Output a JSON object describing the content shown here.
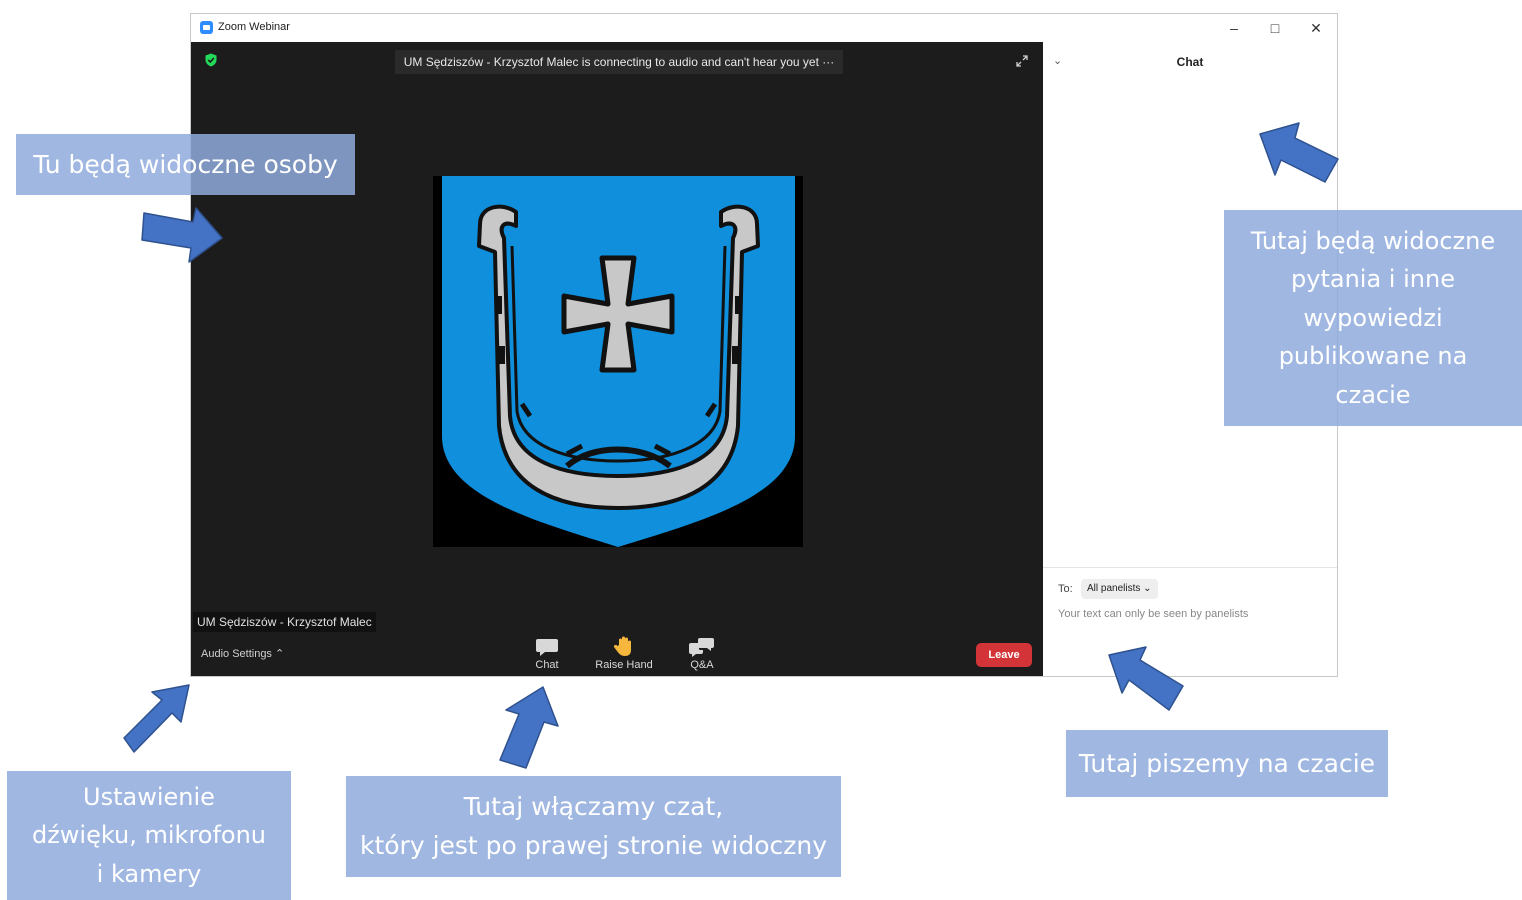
{
  "window": {
    "title": "Zoom Webinar",
    "controls": {
      "minimize": "–",
      "maximize": "□",
      "close": "✕"
    }
  },
  "video": {
    "notice": "UM Sędziszów - Krzysztof Malec is connecting to audio and can't hear you yet  ···",
    "participant_name": "UM Sędziszów - Krzysztof Malec",
    "audio_settings": "Audio Settings  ⌃",
    "toolbar": [
      {
        "label": "Chat",
        "icon": "chat-icon"
      },
      {
        "label": "Raise Hand",
        "icon": "hand-icon"
      },
      {
        "label": "Q&A",
        "icon": "qa-icon"
      }
    ],
    "leave": "Leave"
  },
  "chat": {
    "title": "Chat",
    "collapse": "⌄",
    "to_label": "To:",
    "recipient": "All panelists ⌄",
    "hint": "Your text can only be seen by panelists"
  },
  "annotations": {
    "people": "Tu będą widoczne osoby",
    "questions": "Tutaj będą widoczne\npytania i inne\nwypowiedzi\npublikowane na\nczacie",
    "write_chat": "Tutaj piszemy na czacie",
    "audio": "Ustawienie\ndźwięku, mikrofonu\ni kamery",
    "enable_chat": "Tutaj włączamy czat,\nktóry jest po prawej stronie widoczny"
  },
  "colors": {
    "video_bg": "#1c1c1c",
    "leave": "#d23438",
    "callout": "#8faadc",
    "arrow": "#4472c4",
    "crest_blue": "#0f8fdc",
    "horseshoe": "#c8c8c8"
  }
}
